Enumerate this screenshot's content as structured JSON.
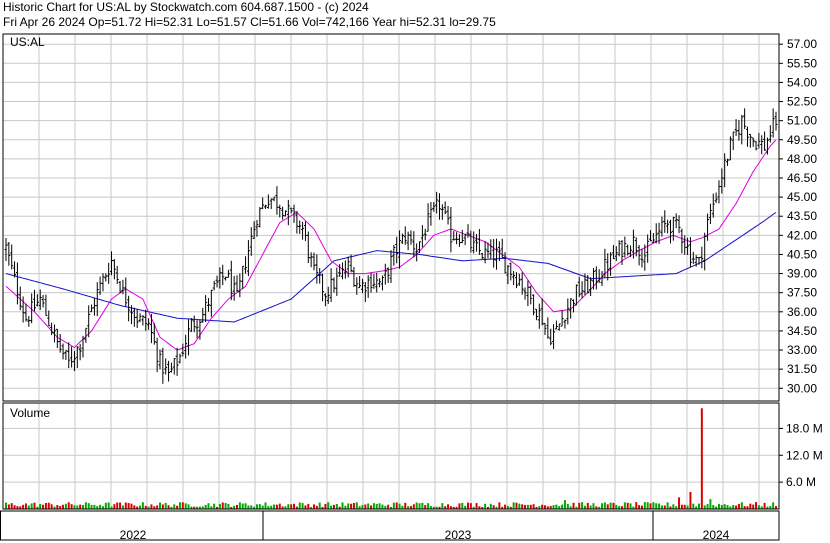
{
  "header": {
    "line1": "Historic Chart for US:AL by Stockwatch.com 604.687.1500 - (c) 2024",
    "line2": "Fri Apr 26 2024   Op=51.72   Hi=52.31   Lo=51.57   Cl=51.66   Vol=742,166   Year hi=52.31   lo=29.75"
  },
  "colors": {
    "price_bar": "#000000",
    "ma_short": "#dd00dd",
    "ma_long": "#1010cc",
    "volume_up": "#00aa00",
    "volume_down": "#dd0000",
    "grid": "#c8c8c8",
    "border": "#000000"
  },
  "chart_data": [
    {
      "type": "ohlc",
      "symbol_label": "US:AL",
      "ylim": [
        29.0,
        57.8
      ],
      "y_ticks": [
        "57.00",
        "55.50",
        "54.00",
        "52.50",
        "51.00",
        "49.50",
        "48.00",
        "46.50",
        "45.00",
        "43.50",
        "42.00",
        "40.50",
        "39.00",
        "37.50",
        "36.00",
        "34.50",
        "33.00",
        "31.50",
        "30.00"
      ],
      "x_labels": [
        "2022",
        "2023",
        "2024"
      ],
      "grid": true,
      "close_knots": [
        [
          0,
          41.0
        ],
        [
          3,
          38.5
        ],
        [
          7,
          35.5
        ],
        [
          12,
          37.0
        ],
        [
          18,
          33.5
        ],
        [
          22,
          32.0
        ],
        [
          26,
          33.5
        ],
        [
          32,
          37.5
        ],
        [
          37,
          40.0
        ],
        [
          41,
          37.5
        ],
        [
          46,
          35.5
        ],
        [
          50,
          35.0
        ],
        [
          54,
          32.0
        ],
        [
          57,
          31.0
        ],
        [
          61,
          32.5
        ],
        [
          65,
          35.0
        ],
        [
          69,
          35.8
        ],
        [
          73,
          37.8
        ],
        [
          77,
          39.0
        ],
        [
          81,
          37.0
        ],
        [
          84,
          40.0
        ],
        [
          88,
          43.5
        ],
        [
          92,
          45.0
        ],
        [
          96,
          44.5
        ],
        [
          100,
          43.5
        ],
        [
          104,
          42.5
        ],
        [
          108,
          39.0
        ],
        [
          112,
          37.5
        ],
        [
          116,
          38.5
        ],
        [
          120,
          39.5
        ],
        [
          124,
          38.0
        ],
        [
          128,
          38.5
        ],
        [
          132,
          38.2
        ],
        [
          136,
          40.5
        ],
        [
          140,
          42.0
        ],
        [
          144,
          41.0
        ],
        [
          148,
          43.0
        ],
        [
          152,
          44.5
        ],
        [
          156,
          42.0
        ],
        [
          160,
          42.0
        ],
        [
          164,
          41.0
        ],
        [
          168,
          40.5
        ],
        [
          172,
          40.5
        ],
        [
          176,
          39.5
        ],
        [
          180,
          38.5
        ],
        [
          184,
          37.0
        ],
        [
          188,
          35.5
        ],
        [
          190,
          34.0
        ],
        [
          193,
          34.5
        ],
        [
          196,
          36.0
        ],
        [
          200,
          37.5
        ],
        [
          204,
          38.0
        ],
        [
          208,
          39.0
        ],
        [
          212,
          40.0
        ],
        [
          216,
          41.0
        ],
        [
          220,
          41.5
        ],
        [
          224,
          40.5
        ],
        [
          228,
          42.0
        ],
        [
          232,
          43.0
        ],
        [
          236,
          42.5
        ],
        [
          240,
          40.5
        ],
        [
          243,
          39.8
        ],
        [
          246,
          43.0
        ],
        [
          250,
          46.0
        ],
        [
          254,
          49.0
        ],
        [
          258,
          51.0
        ],
        [
          262,
          49.5
        ],
        [
          266,
          49.0
        ],
        [
          270,
          51.0
        ]
      ],
      "ma_short_knots": [
        [
          0,
          38.0
        ],
        [
          10,
          36.0
        ],
        [
          18,
          34.0
        ],
        [
          24,
          33.2
        ],
        [
          30,
          34.5
        ],
        [
          37,
          37.0
        ],
        [
          42,
          37.8
        ],
        [
          48,
          37.0
        ],
        [
          54,
          34.0
        ],
        [
          60,
          33.0
        ],
        [
          66,
          33.5
        ],
        [
          72,
          35.5
        ],
        [
          78,
          37.0
        ],
        [
          84,
          38.0
        ],
        [
          90,
          40.5
        ],
        [
          96,
          43.0
        ],
        [
          102,
          43.8
        ],
        [
          108,
          42.5
        ],
        [
          114,
          40.0
        ],
        [
          120,
          39.0
        ],
        [
          126,
          39.0
        ],
        [
          132,
          39.2
        ],
        [
          138,
          39.5
        ],
        [
          144,
          40.5
        ],
        [
          150,
          42.0
        ],
        [
          156,
          42.5
        ],
        [
          162,
          42.0
        ],
        [
          168,
          41.5
        ],
        [
          174,
          40.5
        ],
        [
          180,
          39.5
        ],
        [
          186,
          37.5
        ],
        [
          192,
          36.0
        ],
        [
          198,
          36.2
        ],
        [
          204,
          37.5
        ],
        [
          210,
          39.0
        ],
        [
          216,
          40.0
        ],
        [
          222,
          40.8
        ],
        [
          228,
          41.5
        ],
        [
          234,
          42.0
        ],
        [
          240,
          41.5
        ],
        [
          244,
          41.8
        ],
        [
          250,
          42.5
        ],
        [
          256,
          44.5
        ],
        [
          262,
          47.0
        ],
        [
          268,
          49.0
        ],
        [
          270,
          49.5
        ]
      ],
      "ma_long_knots": [
        [
          0,
          39.0
        ],
        [
          20,
          37.8
        ],
        [
          40,
          36.5
        ],
        [
          60,
          35.5
        ],
        [
          80,
          35.2
        ],
        [
          100,
          37.0
        ],
        [
          115,
          40.0
        ],
        [
          130,
          40.8
        ],
        [
          145,
          40.5
        ],
        [
          160,
          40.0
        ],
        [
          175,
          40.2
        ],
        [
          190,
          39.8
        ],
        [
          205,
          38.6
        ],
        [
          220,
          38.8
        ],
        [
          235,
          39.0
        ],
        [
          245,
          40.0
        ],
        [
          255,
          41.5
        ],
        [
          265,
          43.0
        ],
        [
          270,
          43.8
        ]
      ]
    },
    {
      "type": "bar",
      "title": "Volume",
      "y_ticks": [
        "18.0 M",
        "12.0 M",
        "6.0 M"
      ],
      "ylim": [
        0,
        23.0
      ],
      "spikes": [
        {
          "index": 244,
          "value": 22.5
        },
        {
          "index": 240,
          "value": 3.8
        },
        {
          "index": 236,
          "value": 2.6
        },
        {
          "index": 247,
          "value": 2.2
        },
        {
          "index": 196,
          "value": 2.0
        }
      ]
    }
  ]
}
